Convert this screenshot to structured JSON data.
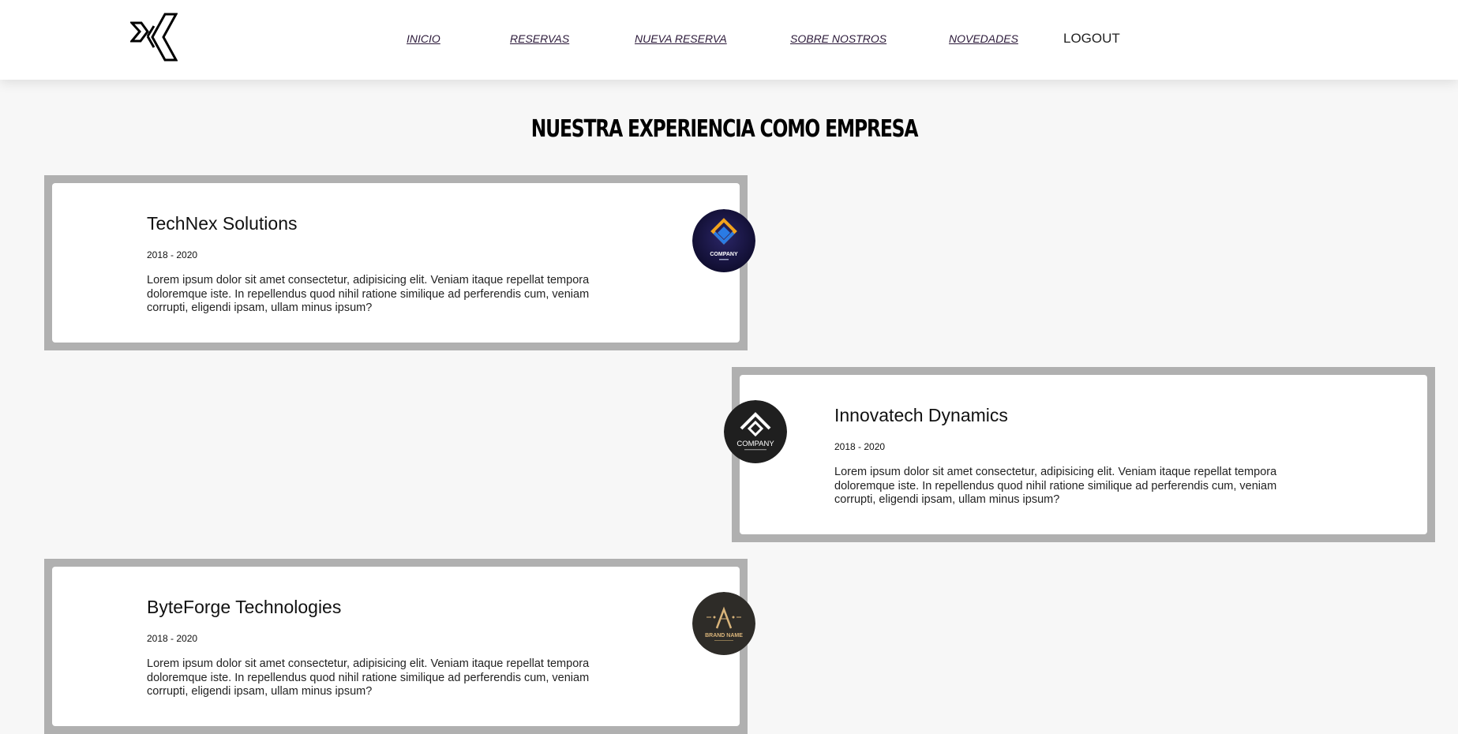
{
  "nav": {
    "items": [
      {
        "label": "INICIO"
      },
      {
        "label": "RESERVAS"
      },
      {
        "label": "NUEVA RESERVA"
      },
      {
        "label": "SOBRE NOSTROS"
      },
      {
        "label": "NOVEDADES"
      }
    ],
    "logout_label": "LOGOUT"
  },
  "page": {
    "title": "NUESTRA EXPERIENCIA COMO EMPRESA"
  },
  "experiences": [
    {
      "company": "TechNex Solutions",
      "dates": "2018 - 2020",
      "description": "Lorem ipsum dolor sit amet consectetur, adipisicing elit. Veniam itaque repellat tempora doloremque iste. In repellendus quod nihil ratione similique ad perferendis cum, veniam corrupti, eligendi ipsam, ullam minus ipsum?",
      "logo_text": "COMPANY",
      "logo_icon": "diamond-logo-icon"
    },
    {
      "company": "Innovatech Dynamics",
      "dates": "2018 - 2020",
      "description": "Lorem ipsum dolor sit amet consectetur, adipisicing elit. Veniam itaque repellat tempora doloremque iste. In repellendus quod nihil ratione similique ad perferendis cum, veniam corrupti, eligendi ipsam, ullam minus ipsum?",
      "logo_text": "COMPANY",
      "logo_icon": "roof-logo-icon"
    },
    {
      "company": "ByteForge Technologies",
      "dates": "2018 - 2020",
      "description": "Lorem ipsum dolor sit amet consectetur, adipisicing elit. Veniam itaque repellat tempora doloremque iste. In repellendus quod nihil ratione similique ad perferendis cum, veniam corrupti, eligendi ipsam, ullam minus ipsum?",
      "logo_text": "BRAND NAME",
      "logo_icon": "a-letter-logo-icon"
    }
  ],
  "colors": {
    "frame": "#b0b0b0",
    "nav_link": "#2c1a3a",
    "badge1": "#14123a",
    "badge2": "#1f1f1f",
    "badge3": "#2e2c28",
    "badge3_gold": "#d9b47a"
  }
}
